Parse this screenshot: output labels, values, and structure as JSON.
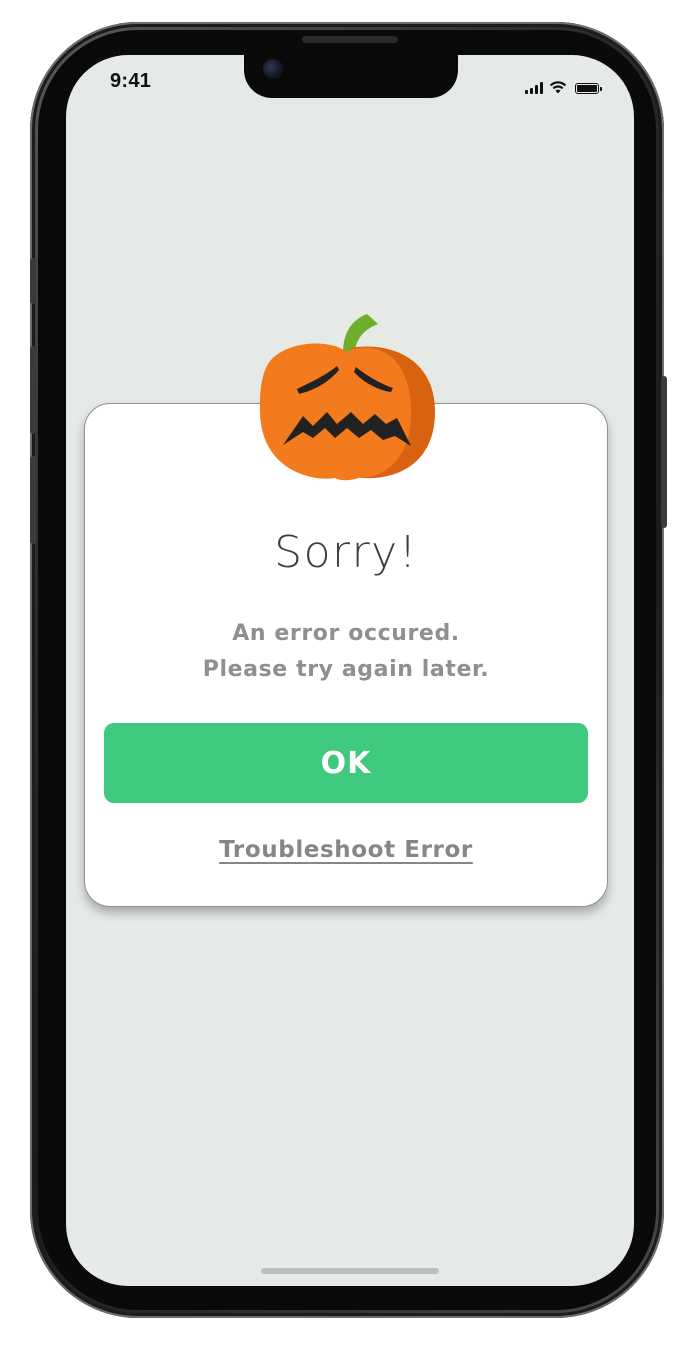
{
  "status_bar": {
    "time": "9:41",
    "icons": [
      "cellular-signal-icon",
      "wifi-icon",
      "battery-icon"
    ]
  },
  "dialog": {
    "illustration": "sad-pumpkin-icon",
    "title": "Sorry!",
    "message_line_1": "An error occured.",
    "message_line_2": "Please try again later.",
    "ok_label": "OK",
    "troubleshoot_label": "Troubleshoot Error"
  },
  "colors": {
    "screen_background": "#e5eae7",
    "dialog_background": "#ffffff",
    "primary_button": "#3ec97f",
    "primary_button_text": "#ffffff",
    "title_text": "#3e3e3e",
    "secondary_text": "#8f8f8f",
    "pumpkin_orange": "#f47b1d",
    "pumpkin_shade": "#d8620f",
    "pumpkin_stem": "#6fae2b"
  }
}
